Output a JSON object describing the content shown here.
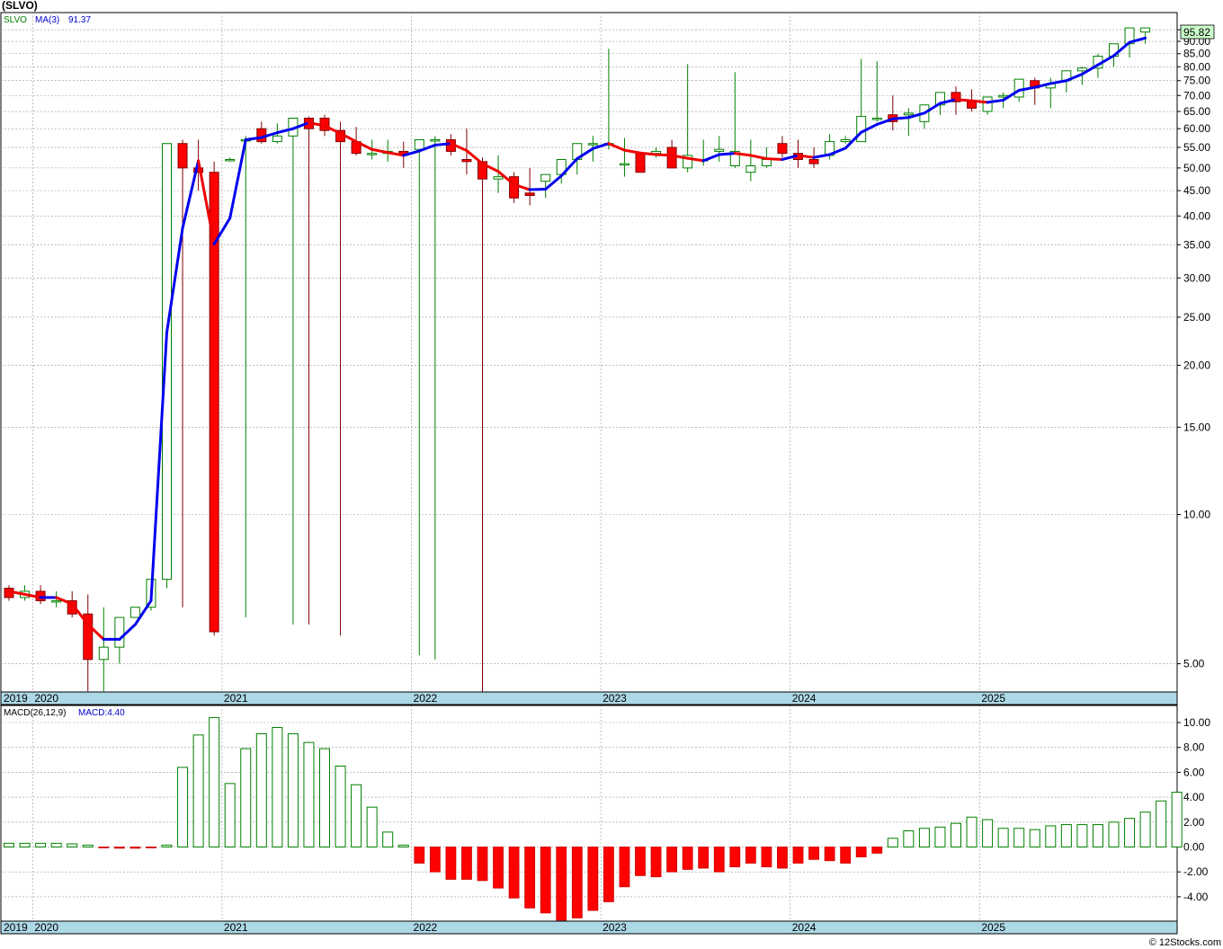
{
  "title": "(SLVO)",
  "watermark": "© 12Stocks.com",
  "colors": {
    "up": "#008000",
    "down": "#ff0000",
    "ma_up": "#0000ee",
    "ma_down": "#ee0000",
    "axis_band": "#add8e6",
    "grid": "#999999",
    "last_label_bg": "#ccffcc"
  },
  "price_panel": {
    "legend_symbol": "SLVO",
    "legend_ma_label": "MA(3)",
    "legend_ma_value": "91.37",
    "last_price_label": "95.82",
    "y_scale": "log",
    "y_ticks": [
      "5.00",
      "10.00",
      "15.00",
      "20.00",
      "25.00",
      "30.00",
      "35.00",
      "40.00",
      "45.00",
      "50.00",
      "55.00",
      "60.00",
      "65.00",
      "70.00",
      "75.00",
      "80.00",
      "85.00",
      "90.00",
      "95.00"
    ]
  },
  "macd_panel": {
    "legend_label": "MACD(26,12,9)",
    "legend_value": "MACD:4.40",
    "y_ticks": [
      "-4.00",
      "-2.00",
      "0.00",
      "2.00",
      "4.00",
      "6.00",
      "8.00",
      "10.00"
    ]
  },
  "x_axis_labels": [
    "2019",
    "2020",
    "2021",
    "2022",
    "2023",
    "2024",
    "2025"
  ],
  "chart_data": [
    {
      "type": "candlestick",
      "title": "(SLVO)",
      "series_names": [
        "SLVO",
        "MA(3)"
      ],
      "y_scale": "log",
      "x": [
        "2019-11",
        "2019-12",
        "2020-01",
        "2020-02",
        "2020-03",
        "2020-04",
        "2020-05",
        "2020-06",
        "2020-07",
        "2020-08",
        "2020-09",
        "2020-10",
        "2020-11",
        "2020-12",
        "2021-01",
        "2021-02",
        "2021-03",
        "2021-04",
        "2021-05",
        "2021-06",
        "2021-07",
        "2021-08",
        "2021-09",
        "2021-10",
        "2021-11",
        "2021-12",
        "2022-01",
        "2022-02",
        "2022-03",
        "2022-04",
        "2022-05",
        "2022-06",
        "2022-07",
        "2022-08",
        "2022-09",
        "2022-10",
        "2022-11",
        "2022-12",
        "2023-01",
        "2023-02",
        "2023-03",
        "2023-04",
        "2023-05",
        "2023-06",
        "2023-07",
        "2023-08",
        "2023-09",
        "2023-10",
        "2023-11",
        "2023-12",
        "2024-01",
        "2024-02",
        "2024-03",
        "2024-04",
        "2024-05",
        "2024-06",
        "2024-07",
        "2024-08",
        "2024-09",
        "2024-10",
        "2024-11",
        "2024-12",
        "2025-01",
        "2025-02",
        "2025-03",
        "2025-04",
        "2025-05",
        "2025-06",
        "2025-07",
        "2025-08",
        "2025-09",
        "2025-10",
        "2025-11"
      ],
      "open": [
        7.1,
        6.8,
        7.0,
        6.7,
        6.7,
        6.3,
        5.1,
        5.4,
        6.2,
        6.5,
        7.4,
        56.0,
        50.0,
        49.0,
        52.0,
        57.0,
        60.0,
        56.5,
        58.0,
        63.0,
        63.0,
        59.5,
        56.5,
        53.5,
        53.5,
        54.0,
        54.5,
        57.0,
        57.0,
        52.0,
        51.5,
        47.5,
        48.0,
        44.5,
        47.0,
        48.5,
        52.0,
        56.0,
        56.0,
        51.0,
        53.5,
        53.5,
        55.0,
        50.0,
        52.0,
        54.0,
        50.5,
        49.0,
        50.5,
        56.0,
        53.5,
        52.0,
        53.0,
        56.5,
        56.5,
        63.0,
        64.0,
        64.0,
        62.0,
        67.0,
        71.0,
        68.0,
        65.0,
        69.5,
        69.5,
        75.0,
        72.5,
        75.0,
        78.5,
        79.5,
        84.0,
        89.0,
        94.0
      ],
      "high": [
        7.2,
        7.2,
        7.2,
        7.0,
        7.0,
        6.9,
        6.5,
        5.8,
        6.4,
        6.6,
        7.4,
        57.0,
        57.0,
        51.5,
        52.5,
        58.0,
        62.0,
        61.5,
        60.0,
        63.5,
        64.0,
        62.0,
        60.5,
        57.0,
        57.0,
        56.5,
        54.5,
        58.0,
        58.5,
        60.0,
        52.5,
        53.0,
        49.0,
        50.0,
        47.5,
        49.0,
        52.5,
        58.0,
        87.0,
        57.5,
        53.5,
        55.0,
        57.0,
        81.0,
        57.0,
        58.0,
        78.0,
        57.0,
        55.0,
        58.0,
        57.0,
        55.0,
        58.5,
        58.0,
        83.0,
        82.0,
        70.0,
        66.0,
        65.0,
        68.0,
        73.0,
        72.0,
        69.0,
        71.0,
        72.0,
        76.0,
        76.0,
        76.5,
        80.0,
        85.0,
        87.5,
        92.0,
        96.0
      ],
      "low": [
        6.7,
        6.7,
        6.6,
        6.5,
        6.2,
        4.4,
        4.2,
        5.0,
        6.2,
        6.4,
        7.1,
        6.5,
        45.0,
        5.7,
        51.5,
        6.2,
        56.0,
        56.0,
        6.0,
        6.0,
        58.0,
        5.7,
        53.0,
        52.0,
        51.5,
        50.0,
        5.2,
        5.1,
        53.0,
        48.5,
        4.3,
        44.5,
        42.5,
        42.0,
        43.5,
        46.5,
        48.5,
        51.5,
        54.5,
        48.0,
        51.0,
        52.5,
        50.0,
        49.0,
        50.5,
        51.5,
        50.0,
        47.0,
        50.0,
        52.5,
        50.0,
        50.0,
        52.0,
        56.0,
        58.0,
        62.0,
        59.5,
        58.0,
        60.0,
        64.0,
        64.0,
        65.0,
        64.0,
        66.0,
        68.0,
        67.0,
        66.0,
        71.0,
        73.5,
        76.0,
        80.0,
        83.5,
        89.0
      ],
      "close": [
        6.8,
        7.0,
        6.7,
        6.7,
        6.3,
        5.1,
        5.4,
        6.2,
        6.5,
        7.4,
        56.0,
        50.0,
        49.0,
        5.8,
        52.0,
        57.0,
        56.5,
        58.0,
        63.0,
        60.0,
        59.5,
        56.5,
        53.5,
        53.5,
        54.0,
        53.0,
        57.0,
        57.0,
        54.0,
        51.5,
        47.5,
        48.0,
        43.5,
        44.0,
        48.5,
        52.0,
        56.0,
        56.0,
        56.0,
        51.0,
        49.0,
        54.0,
        50.0,
        53.0,
        52.0,
        54.5,
        54.0,
        50.5,
        52.0,
        53.5,
        52.0,
        51.0,
        56.5,
        57.0,
        63.5,
        63.0,
        62.0,
        64.5,
        67.0,
        71.0,
        68.0,
        66.0,
        69.5,
        70.0,
        75.5,
        72.5,
        74.0,
        78.5,
        79.5,
        84.0,
        89.0,
        95.8,
        95.8
      ],
      "ma3": [
        7.0,
        6.9,
        6.8,
        6.8,
        6.6,
        6.0,
        5.6,
        5.6,
        6.0,
        6.7,
        23.3,
        37.8,
        51.7,
        35.1,
        39.6,
        57.0,
        57.6,
        58.9,
        60.0,
        61.7,
        60.8,
        58.7,
        56.5,
        54.5,
        53.7,
        53.0,
        54.1,
        55.6,
        56.0,
        54.2,
        51.0,
        49.2,
        46.3,
        45.2,
        45.3,
        48.2,
        52.2,
        54.7,
        56.0,
        54.3,
        53.6,
        53.2,
        53.0,
        52.3,
        51.7,
        53.2,
        53.5,
        53.0,
        52.2,
        52.0,
        53.0,
        52.5,
        53.2,
        54.8,
        59.0,
        61.2,
        62.8,
        63.2,
        64.5,
        67.5,
        68.7,
        68.3,
        67.8,
        68.5,
        71.7,
        72.7,
        74.0,
        75.0,
        77.3,
        80.7,
        84.2,
        89.6,
        91.4
      ]
    },
    {
      "type": "bar",
      "title": "MACD(26,12,9)",
      "series_names": [
        "MACD"
      ],
      "x": [
        "2019-11",
        "2019-12",
        "2020-01",
        "2020-02",
        "2020-03",
        "2020-04",
        "2020-05",
        "2020-06",
        "2020-07",
        "2020-08",
        "2020-09",
        "2020-10",
        "2020-11",
        "2020-12",
        "2021-01",
        "2021-02",
        "2021-03",
        "2021-04",
        "2021-05",
        "2021-06",
        "2021-07",
        "2021-08",
        "2021-09",
        "2021-10",
        "2021-11",
        "2021-12",
        "2022-01",
        "2022-02",
        "2022-03",
        "2022-04",
        "2022-05",
        "2022-06",
        "2022-07",
        "2022-08",
        "2022-09",
        "2022-10",
        "2022-11",
        "2022-12",
        "2023-01",
        "2023-02",
        "2023-03",
        "2023-04",
        "2023-05",
        "2023-06",
        "2023-07",
        "2023-08",
        "2023-09",
        "2023-10",
        "2023-11",
        "2023-12",
        "2024-01",
        "2024-02",
        "2024-03",
        "2024-04",
        "2024-05",
        "2024-06",
        "2024-07",
        "2024-08",
        "2024-09",
        "2024-10",
        "2024-11",
        "2024-12",
        "2025-01",
        "2025-02",
        "2025-03",
        "2025-04",
        "2025-05",
        "2025-06",
        "2025-07",
        "2025-08",
        "2025-09",
        "2025-10",
        "2025-11"
      ],
      "values": [
        0.3,
        0.3,
        0.3,
        0.3,
        0.25,
        0.15,
        -0.05,
        -0.1,
        -0.1,
        -0.05,
        0.15,
        6.4,
        9.0,
        10.4,
        5.1,
        7.9,
        9.1,
        9.6,
        9.1,
        8.4,
        7.9,
        6.5,
        5.0,
        3.2,
        1.2,
        0.15,
        -1.3,
        -2.0,
        -2.6,
        -2.6,
        -2.7,
        -3.3,
        -4.1,
        -4.9,
        -5.3,
        -5.9,
        -5.7,
        -5.1,
        -4.4,
        -3.2,
        -2.3,
        -2.4,
        -2.0,
        -1.8,
        -1.7,
        -2.0,
        -1.6,
        -1.3,
        -1.6,
        -1.7,
        -1.3,
        -1.0,
        -1.1,
        -1.3,
        -0.8,
        -0.5,
        0.7,
        1.3,
        1.5,
        1.6,
        1.9,
        2.4,
        2.2,
        1.5,
        1.5,
        1.4,
        1.7,
        1.8,
        1.8,
        1.8,
        2.0,
        2.3,
        2.8,
        3.7,
        4.4
      ],
      "ylim": [
        -5.8,
        11.0
      ]
    }
  ]
}
